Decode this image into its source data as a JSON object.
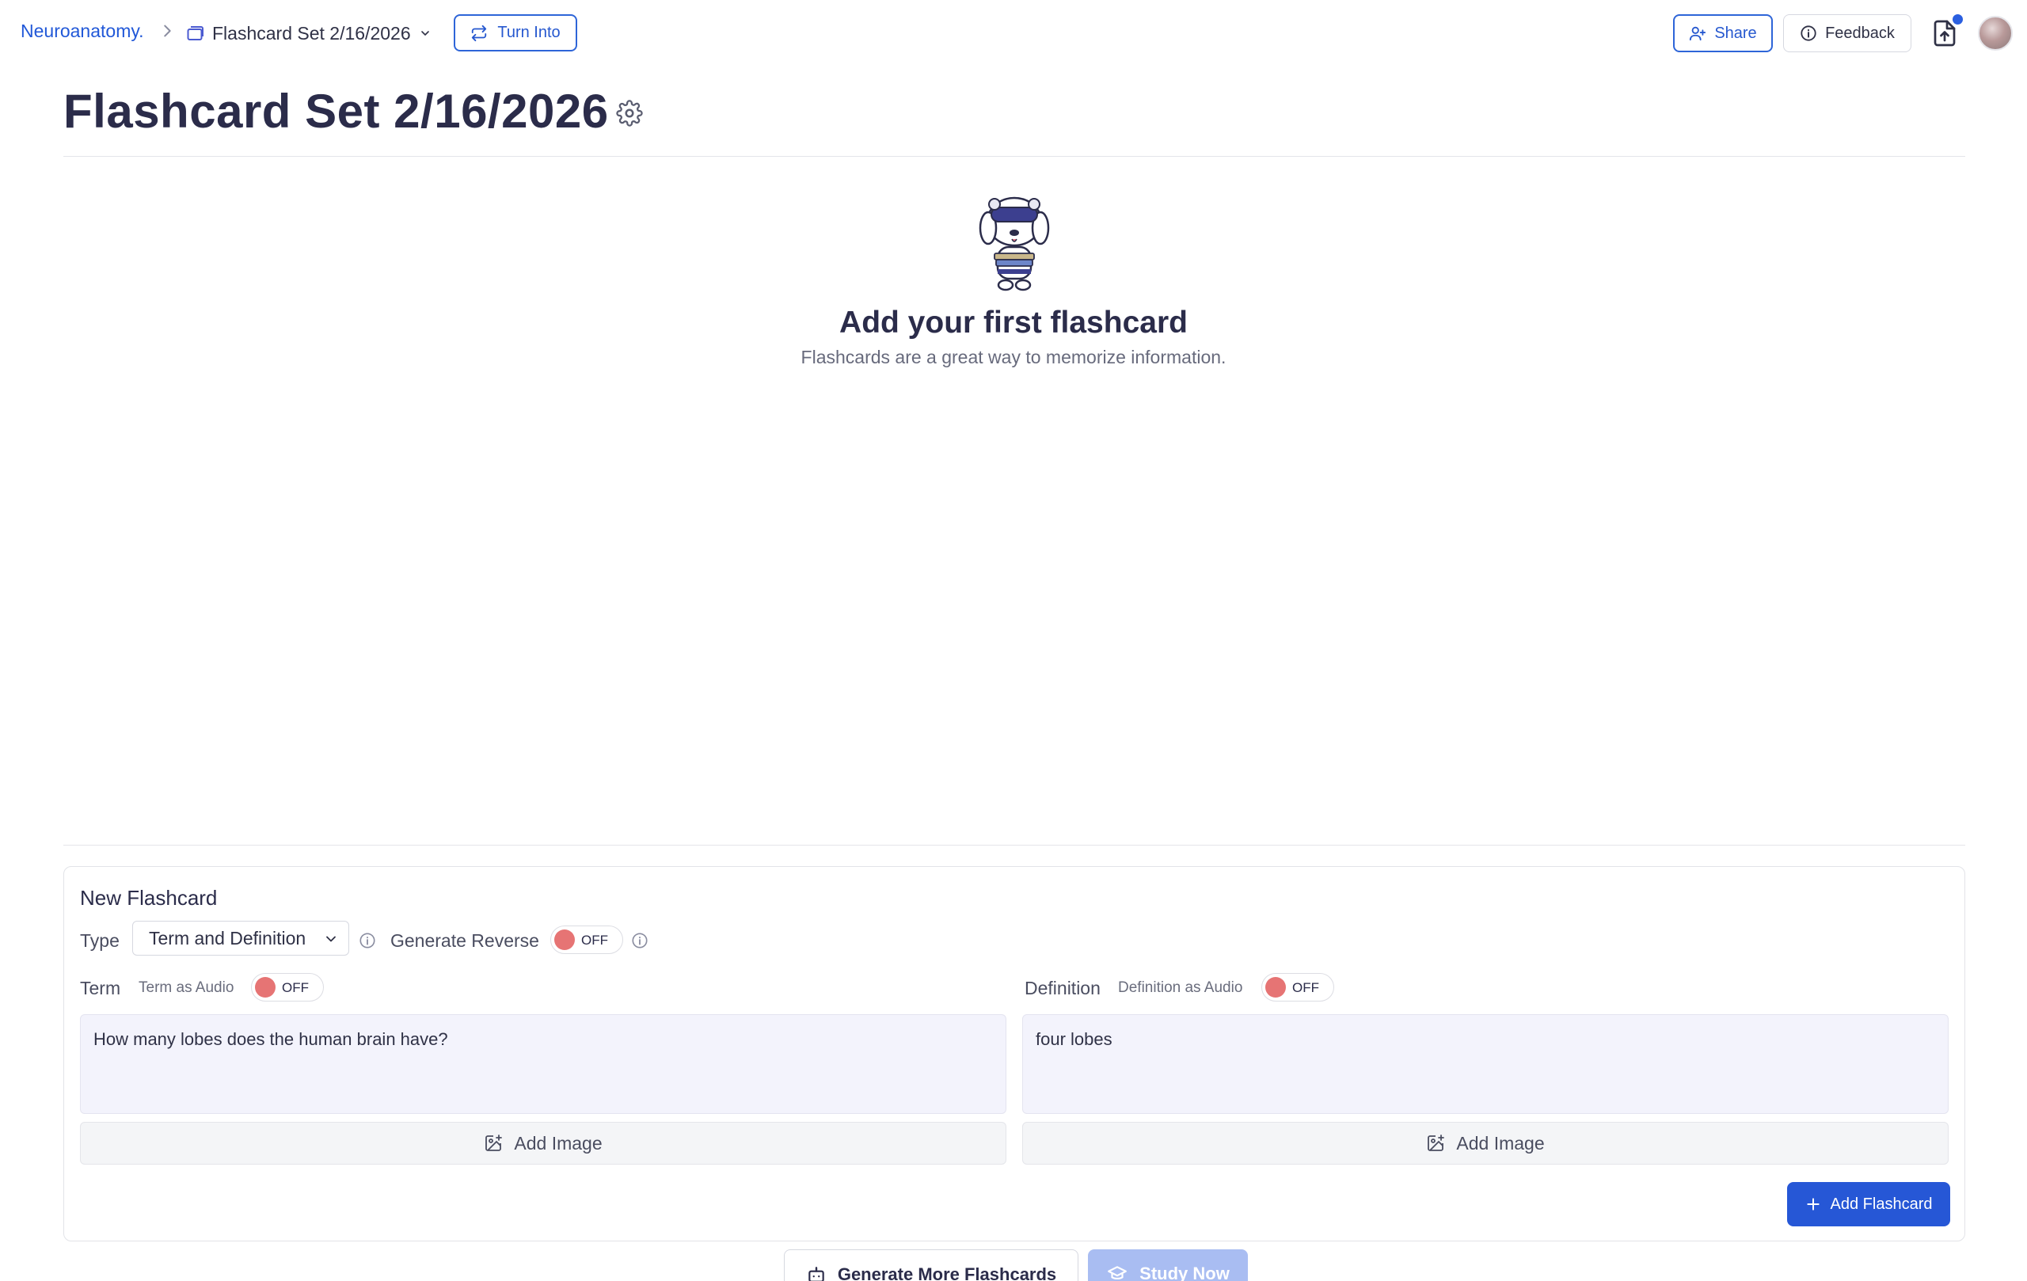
{
  "breadcrumb": {
    "root": "Neuroanatomy.",
    "current": "Flashcard Set 2/16/2026"
  },
  "toolbar": {
    "turn_into_label": "Turn Into",
    "share_label": "Share",
    "feedback_label": "Feedback"
  },
  "page": {
    "title": "Flashcard Set 2/16/2026"
  },
  "empty_state": {
    "title": "Add your first flashcard",
    "subtitle": "Flashcards are a great way to memorize information."
  },
  "form": {
    "title": "New Flashcard",
    "type_label": "Type",
    "type_value": "Term and Definition",
    "generate_reverse_label": "Generate Reverse",
    "generate_reverse_state": "OFF",
    "term_label": "Term",
    "term_audio_label": "Term as Audio",
    "term_audio_state": "OFF",
    "term_value": "How many lobes does the human brain have?",
    "definition_label": "Definition",
    "definition_audio_label": "Definition as Audio",
    "definition_audio_state": "OFF",
    "definition_value": "four lobes",
    "add_image_label": "Add Image",
    "add_flashcard_label": "Add Flashcard"
  },
  "footer": {
    "generate_more_label": "Generate More Flashcards",
    "study_now_label": "Study Now"
  },
  "colors": {
    "accent": "#2657d6",
    "toggle_off": "#e67474",
    "textbox_bg": "#f3f3fc"
  }
}
